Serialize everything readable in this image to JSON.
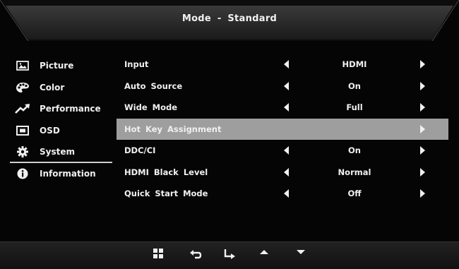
{
  "header": {
    "title": "Mode - Standard"
  },
  "sidebar": {
    "items": [
      {
        "label": "Picture",
        "icon": "picture-icon"
      },
      {
        "label": "Color",
        "icon": "palette-icon"
      },
      {
        "label": "Performance",
        "icon": "trend-icon"
      },
      {
        "label": "OSD",
        "icon": "osd-icon"
      },
      {
        "label": "System",
        "icon": "gear-icon"
      },
      {
        "label": "Information",
        "icon": "info-icon"
      }
    ]
  },
  "main": {
    "rows": [
      {
        "label": "Input",
        "value": "HDMI"
      },
      {
        "label": "Auto Source",
        "value": "On"
      },
      {
        "label": "Wide Mode",
        "value": "Full"
      },
      {
        "label": "Hot Key Assignment",
        "value": ""
      },
      {
        "label": "DDC/CI",
        "value": "On"
      },
      {
        "label": "HDMI Black Level",
        "value": "Normal"
      },
      {
        "label": "Quick Start Mode",
        "value": "Off"
      }
    ]
  },
  "footer": {
    "buttons": [
      "menu-icon",
      "back-icon",
      "enter-icon",
      "up-icon",
      "down-icon"
    ]
  },
  "colors": {
    "background": "#050505",
    "text": "#f0f0f0",
    "highlight": "#9e9e9e"
  }
}
